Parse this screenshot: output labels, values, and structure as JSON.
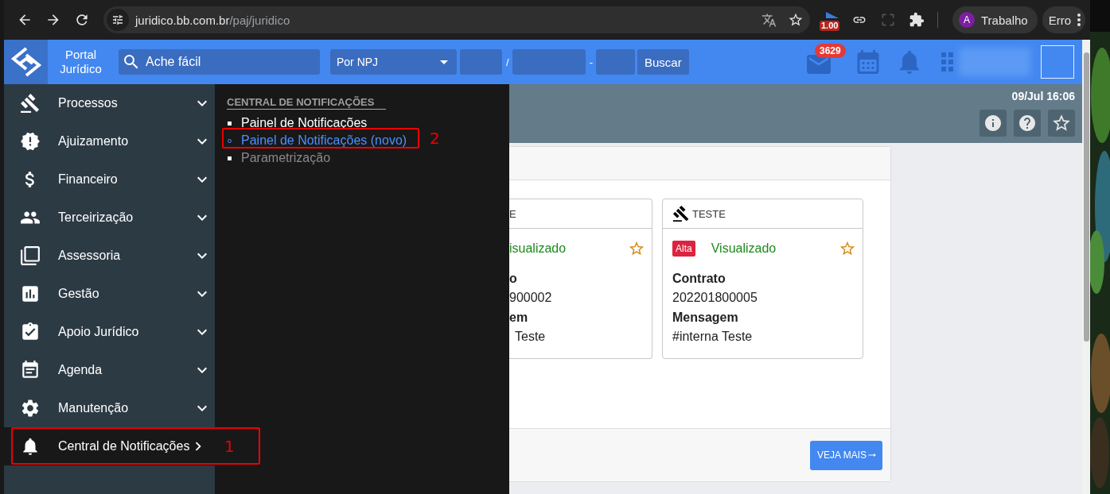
{
  "browser": {
    "url_host": "juridico.bb.com.br",
    "url_path": "/paj/juridico",
    "extension_badge": "1.00",
    "profile": {
      "initial": "A",
      "name": "Trabalho"
    },
    "error_button": "Erro"
  },
  "header": {
    "title_lines": [
      "Portal",
      "Jurídico"
    ],
    "search": {
      "placeholder": "Ache fácil"
    },
    "npj_select": {
      "value": "Por NPJ"
    },
    "separators": [
      "/",
      "-"
    ],
    "search_button": "Buscar",
    "mail_badge": "3629"
  },
  "sidebar": {
    "items": [
      {
        "label": "Processos",
        "selected": false
      },
      {
        "label": "Ajuizamento",
        "selected": false
      },
      {
        "label": "Financeiro",
        "selected": false
      },
      {
        "label": "Terceirização",
        "selected": false
      },
      {
        "label": "Assessoria",
        "selected": false
      },
      {
        "label": "Gestão",
        "selected": false
      },
      {
        "label": "Apoio Jurídico",
        "selected": false
      },
      {
        "label": "Agenda",
        "selected": false
      },
      {
        "label": "Manutenção",
        "selected": false
      },
      {
        "label": "Central de Notificações",
        "selected": true
      }
    ]
  },
  "submenu": {
    "heading": "CENTRAL DE NOTIFICAÇÕES",
    "items": [
      {
        "label": "Painel de Notificações",
        "selected": false,
        "disabled": false
      },
      {
        "label": "Painel de Notificações (novo)",
        "selected": true,
        "disabled": false
      },
      {
        "label": "Parametrização",
        "selected": false,
        "disabled": true
      }
    ]
  },
  "page": {
    "datetime": "09/Jul 16:06",
    "notifications": [
      {
        "clipped": true,
        "title": "E",
        "status": "isualizado",
        "favorite": false,
        "contract_label": "o",
        "contract": "900002",
        "message_label": "em",
        "message": "Teste"
      },
      {
        "clipped": false,
        "title": "TESTE",
        "priority": "Alta",
        "status": "Visualizado",
        "favorite": false,
        "contract_label": "Contrato",
        "contract": "202201800005",
        "message_label": "Mensagem",
        "message": "#interna Teste"
      }
    ],
    "more_button": "VEJA MAIS"
  },
  "annotations": [
    {
      "label": "1"
    },
    {
      "label": "2"
    }
  ]
}
